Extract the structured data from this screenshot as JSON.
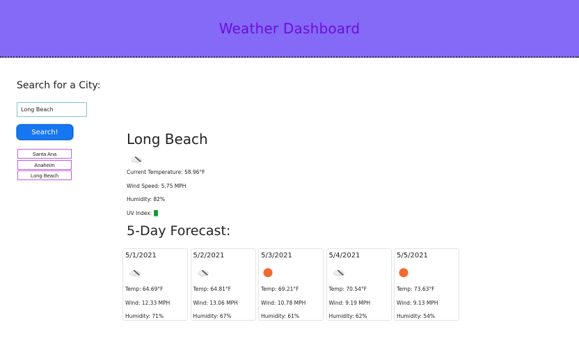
{
  "header": {
    "title": "Weather Dashboard"
  },
  "search": {
    "title": "Search for a City:",
    "input_value": "Long Beach",
    "button_label": "Search!"
  },
  "history": [
    "Santa Ana",
    "Anaheim",
    "Long Beach"
  ],
  "current": {
    "city": "Long Beach",
    "icon": "broken-clouds-icon",
    "temperature": "Current Temperature: 58.96°F",
    "wind": "Wind Speed: 5.75 MPH",
    "humidity": "Humidity: 82%",
    "uv_label": "UV Index: ",
    "uv_value": "0",
    "uv_color": "#1fb84a"
  },
  "forecast": {
    "title": "5-Day Forecast:",
    "days": [
      {
        "date": "5/1/2021",
        "icon": "broken-clouds-icon",
        "temp": "Temp: 64.69°F",
        "wind": "Wind: 12.33 MPH",
        "humidity": "Humidity: 71%"
      },
      {
        "date": "5/2/2021",
        "icon": "broken-clouds-icon",
        "temp": "Temp: 64.81°F",
        "wind": "Wind: 13.06 MPH",
        "humidity": "Humidity: 67%"
      },
      {
        "date": "5/3/2021",
        "icon": "sun-icon",
        "temp": "Temp: 69.21°F",
        "wind": "Wind: 10.78 MPH",
        "humidity": "Humidity: 61%"
      },
      {
        "date": "5/4/2021",
        "icon": "broken-clouds-icon",
        "temp": "Temp: 70.54°F",
        "wind": "Wind: 9.19 MPH",
        "humidity": "Humidity: 62%"
      },
      {
        "date": "5/5/2021",
        "icon": "sun-icon",
        "temp": "Temp: 73.63°F",
        "wind": "Wind: 9.13 MPH",
        "humidity": "Humidity: 54%"
      }
    ]
  },
  "colors": {
    "header_bg": "#8569f7",
    "header_text": "#6b10d8",
    "button_bg": "#1777f2",
    "history_border": "#c257e8",
    "sun": "#f26a2e"
  }
}
